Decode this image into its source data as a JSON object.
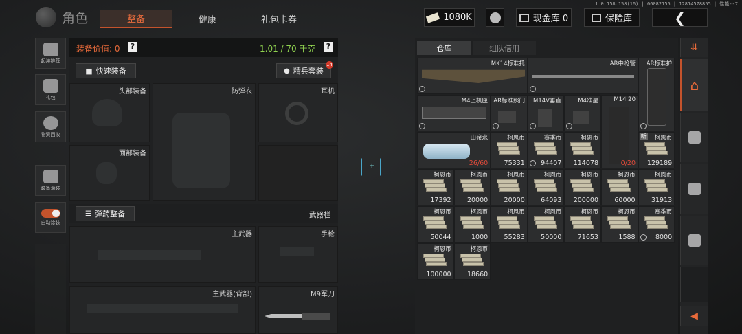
{
  "version": "1.0.158.158(16) | 06082155 | 12814578855 | 性能--7",
  "header": {
    "title": "角色",
    "tabs": [
      "整备",
      "健康",
      "礼包卡券"
    ],
    "money": "1080K",
    "cash_store": "现金库 0",
    "safe_box": "保险库"
  },
  "sidebar": [
    "起装推荐",
    "礼包",
    "物资回收",
    "装备涂装",
    "自动涂装"
  ],
  "equip": {
    "value_label": "装备价值: 0",
    "weight": "1.01 / 70 千克",
    "help": "?",
    "quick_btn": "快速装备",
    "elite_btn": "精兵套装",
    "elite_badge": "14",
    "slots": {
      "head": "头部装备",
      "armor": "防弹衣",
      "ear": "耳机",
      "face": "面部装备"
    },
    "ammo_btn": "弹药整备",
    "weapon_bar": "武器栏",
    "weapons": {
      "main": "主武器",
      "pistol": "手枪",
      "back": "主武器(背部)",
      "knife": "M9军刀"
    }
  },
  "warehouse": {
    "tabs": [
      "仓库",
      "组队借用"
    ],
    "row1": [
      "MK14标准托",
      "AR中枪管",
      "AR标准护"
    ],
    "row2": [
      "M4上机匣",
      "AR标准照门",
      "M14V垂直",
      "M4准星",
      "M14 20"
    ],
    "items": [
      {
        "name": "山泉水",
        "count": "26/60"
      },
      {
        "name": "柯恩币",
        "count": "75331"
      },
      {
        "name": "赛季币",
        "count": "94407"
      },
      {
        "name": "柯恩币",
        "count": "114078"
      },
      {
        "name": "",
        "count": "0/20"
      },
      {
        "name": "柯恩币",
        "count": "129189"
      },
      {
        "name": "柯恩币",
        "count": "17392"
      },
      {
        "name": "柯恩币",
        "count": "20000"
      },
      {
        "name": "柯恩币",
        "count": "20000"
      },
      {
        "name": "柯恩币",
        "count": "64093"
      },
      {
        "name": "柯恩币",
        "count": "200000"
      },
      {
        "name": "柯恩币",
        "count": "60000"
      },
      {
        "name": "柯恩币",
        "count": "31913"
      },
      {
        "name": "柯恩币",
        "count": "50044"
      },
      {
        "name": "柯恩币",
        "count": "1000"
      },
      {
        "name": "柯恩币",
        "count": "55283"
      },
      {
        "name": "柯恩币",
        "count": "50000"
      },
      {
        "name": "柯恩币",
        "count": "71653"
      },
      {
        "name": "柯恩币",
        "count": "1588"
      },
      {
        "name": "赛季币",
        "count": "8000"
      },
      {
        "name": "柯恩币",
        "count": "100000"
      },
      {
        "name": "柯恩币",
        "count": "18660"
      }
    ],
    "new_tag": "新"
  },
  "colors": {
    "accent": "#e56b3d",
    "weight": "#8fd14f",
    "red": "#e04a3a"
  }
}
